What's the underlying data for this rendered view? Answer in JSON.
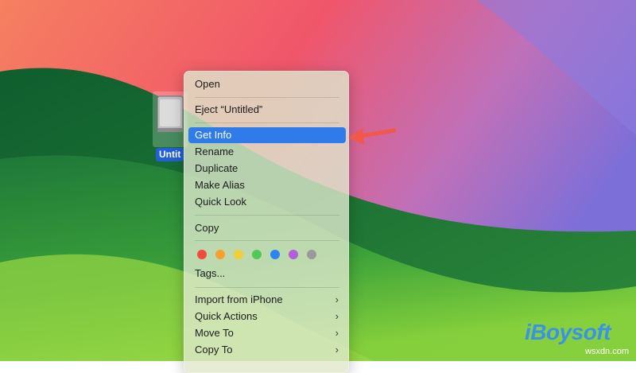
{
  "desktop": {
    "drive_label": "Untit"
  },
  "context_menu": {
    "items": [
      {
        "label": "Open"
      },
      {
        "label": "Eject “Untitled”"
      },
      {
        "label": "Get Info",
        "selected": true
      },
      {
        "label": "Rename"
      },
      {
        "label": "Duplicate"
      },
      {
        "label": "Make Alias"
      },
      {
        "label": "Quick Look"
      },
      {
        "label": "Copy"
      },
      {
        "label": "Tags..."
      },
      {
        "label": "Import from iPhone",
        "submenu": true
      },
      {
        "label": "Quick Actions",
        "submenu": true
      },
      {
        "label": "Move To",
        "submenu": true
      },
      {
        "label": "Copy To",
        "submenu": true
      }
    ],
    "tag_colors": [
      "#ef4b41",
      "#f6a030",
      "#f3cf3a",
      "#52c75a",
      "#2f84f0",
      "#b260da",
      "#9a9a9a"
    ],
    "submenu_icon": "chevron-right-icon"
  },
  "watermark": {
    "brand": "iBoysoft",
    "site": "wsxdn.com"
  },
  "colors": {
    "selection": "#2f7bea",
    "pointer_arrow": "#f2584a",
    "brand": "#3a93e8"
  }
}
